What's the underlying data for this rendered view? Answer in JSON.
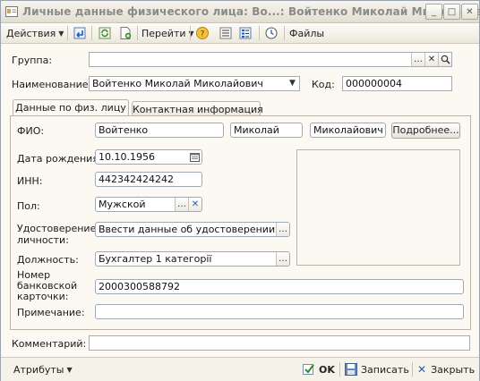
{
  "window": {
    "title": "Личные данные физического лица: Во...: Войтенко Миколай Миколайович",
    "controls": {
      "minimize": "_",
      "maximize": "□",
      "close": "✕"
    }
  },
  "toolbar": {
    "actions_label": "Действия",
    "goto_label": "Перейти",
    "files_label": "Файлы"
  },
  "header": {
    "group_label": "Группа:",
    "group_value": "",
    "name_label": "Наименование:",
    "name_value": "Войтенко Миколай Миколайович",
    "code_label": "Код:",
    "code_value": "000000004"
  },
  "tabs": [
    {
      "label": "Данные по физ. лицу",
      "active": true
    },
    {
      "label": "Контактная информация",
      "active": false
    }
  ],
  "person": {
    "fio_label": "ФИО:",
    "last_name": "Войтенко",
    "first_name": "Миколай",
    "middle_name": "Миколайович",
    "details_button": "Подробнее...",
    "birth_label": "Дата рождения:",
    "birth_value": "10.10.1956",
    "inn_label": "ИНН:",
    "inn_value": "442342424242",
    "sex_label": "Пол:",
    "sex_value": "Мужской",
    "id_label_1": "Удостоверение",
    "id_label_2": "личности:",
    "id_value": "Ввести данные об удостоверении личн",
    "position_label": "Должность:",
    "position_value": "Бухгалтер 1 категорії",
    "card_label_1": "Номер",
    "card_label_2": "банковской",
    "card_label_3": "карточки:",
    "card_value": "2000300588792",
    "note_label": "Примечание:",
    "note_value": ""
  },
  "comment": {
    "label": "Комментарий:",
    "value": ""
  },
  "footer": {
    "attributes_label": "Атрибуты",
    "ok_label": "OK",
    "save_label": "Записать",
    "close_label": "Закрыть"
  },
  "colors": {
    "title_text": "#8a8a8a",
    "window_bg": "#fbf9f2",
    "field_border": "#a5acb5",
    "close_x": "#2a5db0",
    "ok_check": "#2e8b2e"
  }
}
